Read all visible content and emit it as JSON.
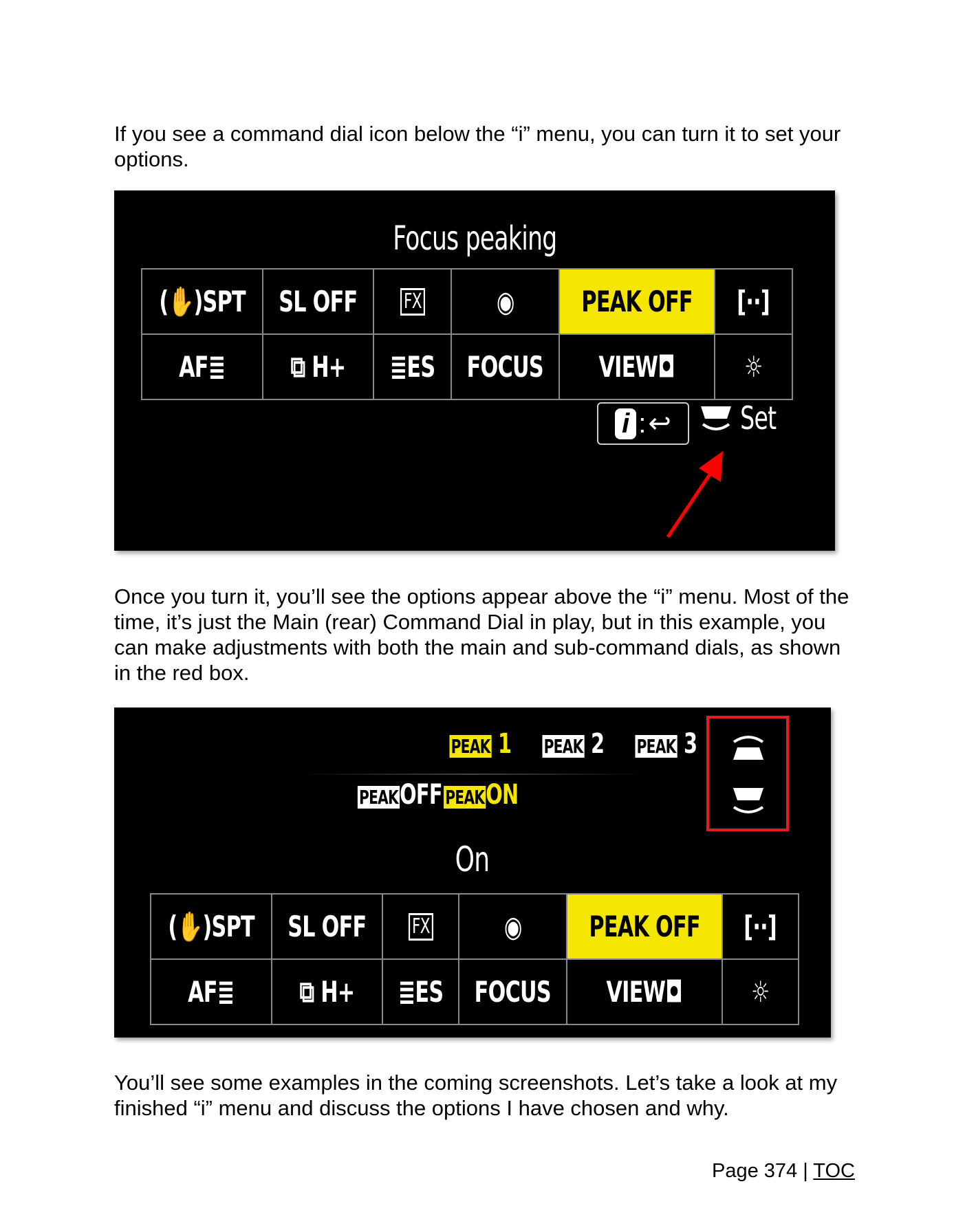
{
  "paragraphs": {
    "p1": "If you see a command dial icon below the “i” menu, you can turn it to set your options.",
    "p2": "Once you turn it, you’ll see the options appear above the “i” menu. Most of the time, it’s just the Main (rear) Command Dial in play, but in this example, you can make adjustments with both the main and sub-command dials, as shown in the red box.",
    "p3": "You’ll see some examples in the coming screenshots. Let’s take a look at my finished “i” menu and discuss the options I have chosen and why."
  },
  "screen1": {
    "title": "Focus peaking",
    "footer_i": "i",
    "footer_back": "↩",
    "footer_set": "Set"
  },
  "screen2": {
    "options_row1": [
      "1",
      "2",
      "3"
    ],
    "options_row2": [
      "OFF",
      "ON"
    ],
    "peak_label": "PEAK",
    "value": "On"
  },
  "menu": {
    "row1": [
      "(✋)SPT",
      "SL OFF",
      "FX",
      "◉",
      "PEAK OFF",
      "[··]"
    ],
    "row2": [
      "AF≣",
      "⧉ H+",
      "≣ES",
      "FOCUS",
      "VIEW◘",
      "☼"
    ]
  },
  "colors": {
    "highlight": "#f5e600",
    "arrow": "#ff0000"
  },
  "footer": {
    "page": "Page 374 |",
    "toc": "TOC"
  }
}
